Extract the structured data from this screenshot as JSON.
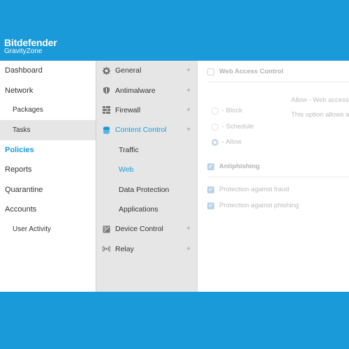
{
  "brand": {
    "name": "Bitdefender",
    "product": "GravityZone"
  },
  "nav": {
    "items": [
      {
        "label": "Dashboard"
      },
      {
        "label": "Network"
      },
      {
        "label": "Packages"
      },
      {
        "label": "Tasks"
      },
      {
        "label": "Policies"
      },
      {
        "label": "Reports"
      },
      {
        "label": "Quarantine"
      },
      {
        "label": "Accounts"
      },
      {
        "label": "User Activity"
      }
    ]
  },
  "menu": {
    "items": [
      {
        "label": "General",
        "icon": "gear-icon"
      },
      {
        "label": "Antimalware",
        "icon": "shield-icon"
      },
      {
        "label": "Firewall",
        "icon": "firewall-icon"
      },
      {
        "label": "Content Control",
        "icon": "database-icon"
      },
      {
        "label": "Traffic"
      },
      {
        "label": "Web"
      },
      {
        "label": "Data Protection"
      },
      {
        "label": "Applications"
      },
      {
        "label": "Device Control",
        "icon": "device-icon"
      },
      {
        "label": "Relay",
        "icon": "relay-icon"
      }
    ],
    "expand_symbol": "+"
  },
  "content": {
    "web_access_control": "Web Access Control",
    "allow_text": "Allow - Web access",
    "option_text": "This option allows a",
    "block": "- Block",
    "schedule": "- Schedule",
    "allow": "- Allow",
    "antiphishing": "Antiphishing",
    "protection_fraud": "Protection against fraud",
    "protection_phishing": "Protection against phishing"
  },
  "colors": {
    "accent": "#1a9ad9",
    "background": "#1a9ad9",
    "menu_bg": "#e6e6e6"
  }
}
